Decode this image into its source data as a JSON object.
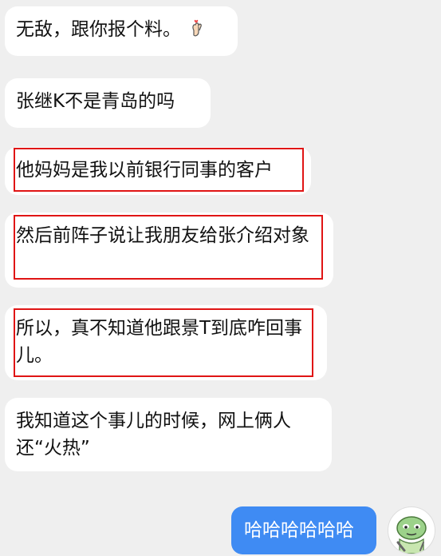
{
  "messages": [
    {
      "id": "m1",
      "direction": "incoming",
      "text": "无敌，跟你报个料。",
      "emoji": "hand-heart-icon",
      "highlighted": false
    },
    {
      "id": "m2",
      "direction": "incoming",
      "text": "张继K不是青岛的吗",
      "highlighted": false
    },
    {
      "id": "m3",
      "direction": "incoming",
      "text": "他妈妈是我以前银行同事的客户",
      "highlighted": true
    },
    {
      "id": "m4",
      "direction": "incoming",
      "text": "然后前阵子说让我朋友给张介绍对象",
      "highlighted": true
    },
    {
      "id": "m5",
      "direction": "incoming",
      "text": "所以，真不知道他跟景T到底咋回事儿。",
      "highlighted": true
    },
    {
      "id": "m6",
      "direction": "incoming",
      "text": "我知道这个事儿的时候，网上俩人还“火热”",
      "highlighted": false
    },
    {
      "id": "m7",
      "direction": "outgoing",
      "text": "哈哈哈哈哈哈",
      "highlighted": false
    }
  ],
  "colors": {
    "background": "#efefef",
    "incoming_bubble": "#ffffff",
    "outgoing_bubble": "#3f8bf3",
    "highlight_border": "#e01515"
  },
  "avatar": {
    "icon": "green-cartoon-turtle-avatar-icon"
  }
}
